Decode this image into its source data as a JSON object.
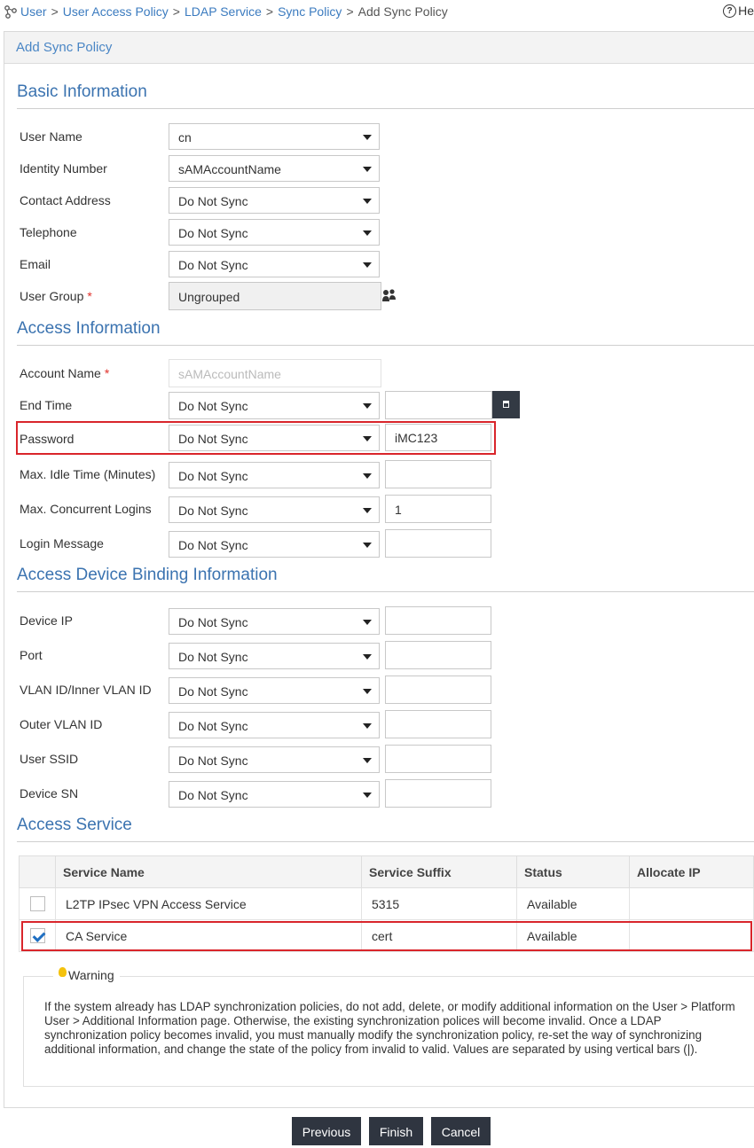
{
  "breadcrumb": {
    "items": [
      "User",
      "User Access Policy",
      "LDAP Service",
      "Sync Policy"
    ],
    "current": "Add Sync Policy",
    "separator": ">"
  },
  "help_label": "He",
  "panel_title": "Add Sync Policy",
  "sections": {
    "basic": "Basic Information",
    "access": "Access Information",
    "binding": "Access Device Binding Information",
    "service": "Access Service"
  },
  "basic_fields": {
    "user_name": {
      "label": "User Name",
      "value": "cn"
    },
    "identity_number": {
      "label": "Identity Number",
      "value": "sAMAccountName"
    },
    "contact_address": {
      "label": "Contact Address",
      "value": "Do Not Sync"
    },
    "telephone": {
      "label": "Telephone",
      "value": "Do Not Sync"
    },
    "email": {
      "label": "Email",
      "value": "Do Not Sync"
    },
    "user_group": {
      "label": "User Group",
      "required": "*",
      "value": "Ungrouped"
    }
  },
  "access_fields": {
    "account_name": {
      "label": "Account Name",
      "required": "*",
      "value": "sAMAccountName"
    },
    "end_time": {
      "label": "End Time",
      "value": "Do Not Sync",
      "extra": ""
    },
    "password": {
      "label": "Password",
      "value": "Do Not Sync",
      "extra": "iMC123"
    },
    "max_idle_time": {
      "label": "Max. Idle Time (Minutes)",
      "value": "Do Not Sync",
      "extra": ""
    },
    "max_concurrent_logins": {
      "label": "Max. Concurrent Logins",
      "value": "Do Not Sync",
      "extra": "1"
    },
    "login_message": {
      "label": "Login Message",
      "value": "Do Not Sync",
      "extra": ""
    }
  },
  "binding_fields": {
    "device_ip": {
      "label": "Device IP",
      "value": "Do Not Sync",
      "extra": ""
    },
    "port": {
      "label": "Port",
      "value": "Do Not Sync",
      "extra": ""
    },
    "vlan_id": {
      "label": "VLAN ID/Inner VLAN ID",
      "value": "Do Not Sync",
      "extra": ""
    },
    "outer_vlan_id": {
      "label": "Outer VLAN ID",
      "value": "Do Not Sync",
      "extra": ""
    },
    "user_ssid": {
      "label": "User SSID",
      "value": "Do Not Sync",
      "extra": ""
    },
    "device_sn": {
      "label": "Device SN",
      "value": "Do Not Sync",
      "extra": ""
    }
  },
  "service_table": {
    "headers": [
      "Service Name",
      "Service Suffix",
      "Status",
      "Allocate IP"
    ],
    "rows": [
      {
        "checked": false,
        "name": "L2TP IPsec VPN Access Service",
        "suffix": "5315",
        "status": "Available",
        "allocate_ip": ""
      },
      {
        "checked": true,
        "name": "CA Service",
        "suffix": "cert",
        "status": "Available",
        "allocate_ip": ""
      }
    ]
  },
  "warning": {
    "title": "Warning",
    "text": "If the system already has LDAP synchronization policies, do not add, delete, or modify additional information on the User > Platform User > Additional Information page. Otherwise, the existing synchronization polices will become invalid. Once a LDAP synchronization policy becomes invalid, you must manually modify the synchronization policy, re-set the way of synchronizing additional information, and change the state of the policy from invalid to valid. Values are separated by using vertical bars (|)."
  },
  "buttons": {
    "previous": "Previous",
    "finish": "Finish",
    "cancel": "Cancel"
  },
  "colors": {
    "link": "#3b7bbf",
    "section_title": "#3b73b0",
    "highlight": "#d9252b",
    "button_bg": "#2f3540",
    "required": "#e0302a"
  },
  "icons": {
    "breadcrumb": "user-tree-icon",
    "help": "question-circle-icon",
    "group": "user-group-icon",
    "calendar": "calendar-icon",
    "warning": "lightbulb-icon"
  }
}
